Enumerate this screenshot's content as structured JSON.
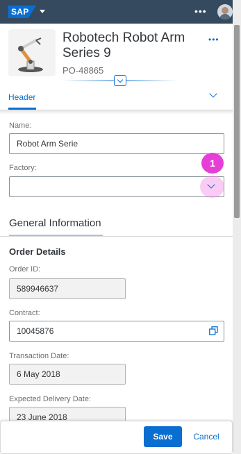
{
  "shell": {
    "logo_text": "SAP",
    "overflow_icon": "more-icon",
    "avatar_icon": "user-avatar"
  },
  "header": {
    "title": "Robotech Robot Arm Series 9",
    "subtitle": "PO-48865",
    "more_icon": "more-icon",
    "collapse_icon": "chevron-down-icon"
  },
  "tabs": {
    "active_label": "Header",
    "expand_icon": "chevron-down-icon"
  },
  "form": {
    "name_label": "Name:",
    "name_value": "Robot Arm Serie",
    "factory_label": "Factory:",
    "factory_value": ""
  },
  "general": {
    "section_title": "General Information",
    "group_title": "Order Details",
    "order_id_label": "Order ID:",
    "order_id_value": "589946637",
    "contract_label": "Contract:",
    "contract_value": "10045876",
    "transaction_date_label": "Transaction Date:",
    "transaction_date_value": "6 May 2018",
    "delivery_date_label": "Expected Delivery Date:",
    "delivery_date_value": "23 June 2018"
  },
  "annotation": {
    "step_number": "1",
    "highlight_color": "#e63fd8"
  },
  "footer": {
    "save_label": "Save",
    "cancel_label": "Cancel"
  },
  "colors": {
    "shell_bg": "#354a5f",
    "accent": "#0a6ed1"
  }
}
